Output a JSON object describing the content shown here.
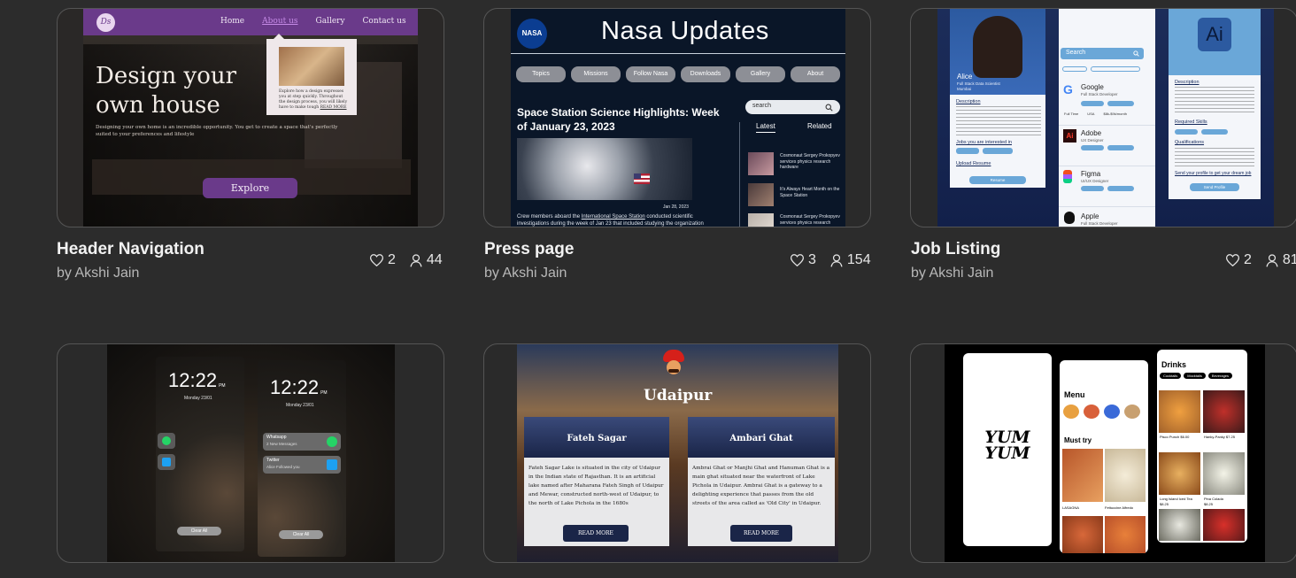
{
  "cards": [
    {
      "title": "Header Navigation",
      "author": "by Akshi Jain",
      "likes": "2",
      "views": "44",
      "preview": {
        "logo": "Ds",
        "nav": [
          "Home",
          "About us",
          "Gallery",
          "Contact us"
        ],
        "headline": "Design your own house",
        "subtext": "Designing your own home is an incredible opportunity. You get to create a space that's perfectly suited to your preferences and lifestyle",
        "popup_text": "Explore how a design expresses you at step quickly. Throughout the design process, you will likely have to make tough",
        "popup_link": "READ MORE",
        "cta": "Explore"
      }
    },
    {
      "title": "Press page",
      "author": "by Akshi Jain",
      "likes": "3",
      "views": "154",
      "preview": {
        "logo": "NASA",
        "heading": "Nasa Updates",
        "tabs": [
          "Topics",
          "Missions",
          "Follow Nasa",
          "Downloads",
          "Gallery",
          "About"
        ],
        "article_title": "Space Station Science Highlights: Week of January 23, 2023",
        "date": "Jan 28, 2023",
        "caption_start": "Crew members aboard the ",
        "caption_link": "International Space Station",
        "caption_end": " conducted scientific investigations during the week of Jan 23 that included studying the organization",
        "search_placeholder": "search",
        "side_tabs": [
          "Latest",
          "Related"
        ],
        "side_items": [
          "Cosmonaut Sergey Prokopyev services physics research hardware",
          "It's Always Heart Month on the Space Station",
          "Cosmonaut Sergey Prokopyev services physics research"
        ]
      }
    },
    {
      "title": "Job Listing",
      "author": "by Akshi Jain",
      "likes": "2",
      "views": "81",
      "preview": {
        "profile_name": "Alice",
        "profile_role": "Full Stack Data Scientist",
        "profile_loc": "Mumbai",
        "sections": [
          "Description",
          "Jobs you are interested in",
          "Upload Resume"
        ],
        "resume_button": "Resume",
        "search_label": "Search",
        "companies": [
          {
            "name": "Google",
            "role": "Full Stack Developer"
          },
          {
            "name": "Adobe",
            "role": "UX Designer"
          },
          {
            "name": "Figma",
            "role": "UI/UX Designer"
          },
          {
            "name": "Apple",
            "role": "Full Stack Developer"
          }
        ],
        "job_meta": [
          "Full Time",
          "USA",
          "$8k-$9k/month"
        ],
        "ai_logo": "Ai",
        "right_sections": [
          "Description",
          "Required Skills",
          "Qualifications"
        ],
        "send_label": "Send your profile to get your dream job",
        "send_button": "Send Profile"
      }
    },
    {
      "title": "",
      "preview": {
        "time": "12:22",
        "date": "Monday 23/01",
        "pm": "PM",
        "notifications": [
          {
            "app": "Whatsapp",
            "text": "2 New Messages"
          },
          {
            "app": "Twitter",
            "text": "Alice Followed you"
          }
        ],
        "clear_label": "Clear All"
      }
    },
    {
      "title": "",
      "preview": {
        "city": "Udaipur",
        "places": [
          {
            "name": "Fateh Sagar",
            "text": "Fateh Sagar Lake is situated in the city of Udaipur in the Indian state of Rajasthan. It is an artificial lake named after Maharana Fateh Singh of Udaipur and Mewar, constructed north-west of Udaipur, to the north of Lake Pichola in the 1680s"
          },
          {
            "name": "Ambari Ghat",
            "text": "Ambrai Ghat or Manjhi Ghat and Hanuman Ghat is a main ghat situated near the waterfront of Lake Pichola in Udaipur. Ambrai Ghat is a gateway to a delighting experience that passes from the old streets of the area called as 'Old City' in Udaipur."
          }
        ],
        "read_more": "READ MORE"
      }
    },
    {
      "title": "",
      "preview": {
        "logo": "YUM YUM",
        "menu_label": "Menu",
        "must_try_label": "Must try",
        "dishes": [
          "LASAGNA",
          "Fettuccine Alfredo"
        ],
        "drinks_label": "Drinks",
        "drink_tabs": [
          "Cocktails",
          "Mocktails",
          "Beverages"
        ],
        "drinks": [
          {
            "name": "Pisco Punch",
            "price": "$6.00"
          },
          {
            "name": "Hanky-Panky",
            "price": "$7.25"
          },
          {
            "name": "Long Island Iced Tea",
            "price": "$8.25"
          },
          {
            "name": "Pina Colada",
            "price": "$8.25"
          }
        ]
      }
    }
  ],
  "colors": {
    "background": "#2c2c2c",
    "card_border": "#555555",
    "purple": "#6a3a8a",
    "nasa_navy": "#0a1628",
    "job_blue": "#6aa7d8"
  }
}
